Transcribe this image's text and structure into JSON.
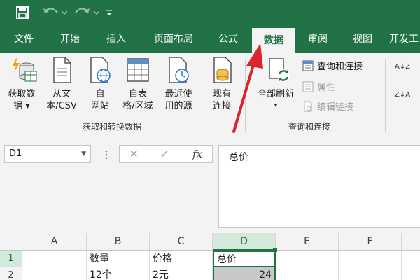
{
  "quick_access": {
    "save_icon": "save-icon",
    "undo_icon": "undo-icon",
    "redo_icon": "redo-icon",
    "customize_icon": "customize-icon"
  },
  "tabs": [
    {
      "label": "文件"
    },
    {
      "label": "开始"
    },
    {
      "label": "插入"
    },
    {
      "label": "页面布局"
    },
    {
      "label": "公式"
    },
    {
      "label": "数据",
      "active": true
    },
    {
      "label": "审阅"
    },
    {
      "label": "视图"
    },
    {
      "label": "开发工"
    }
  ],
  "ribbon": {
    "get_data": {
      "line1": "获取数",
      "line2": "据 ▾"
    },
    "from_text": {
      "line1": "从文",
      "line2": "本/CSV"
    },
    "from_web": {
      "line1": "自",
      "line2": "网站"
    },
    "from_table": {
      "line1": "自表",
      "line2": "格/区域"
    },
    "recent_sources": {
      "line1": "最近使",
      "line2": "用的源"
    },
    "existing_connections": {
      "line1": "现有",
      "line2": "连接"
    },
    "group_get_transform": "获取和转换数据",
    "refresh_all": {
      "line1": "全部刷新",
      "line2": "▾"
    },
    "queries_connections": "查询和连接",
    "properties": "属性",
    "edit_links": "编辑链接",
    "group_queries": "查询和连接",
    "sort_az": "A↓Z",
    "sort_za": "Z↓A"
  },
  "accent_color": "#217346",
  "annotation_arrow_color": "#d9262e",
  "formula_bar": {
    "name_box": "D1",
    "cancel_icon": "✕",
    "enter_icon": "✓",
    "fx_label": "fx",
    "content": "总价"
  },
  "sheet": {
    "columns": [
      "A",
      "B",
      "C",
      "D",
      "E",
      "F"
    ],
    "selected_column": "D",
    "rows": [
      {
        "num": "1",
        "cells": [
          "",
          "数量",
          "价格",
          "总价",
          "",
          ""
        ]
      },
      {
        "num": "2",
        "cells": [
          "",
          "12个",
          "2元",
          "24",
          "",
          ""
        ]
      }
    ]
  }
}
